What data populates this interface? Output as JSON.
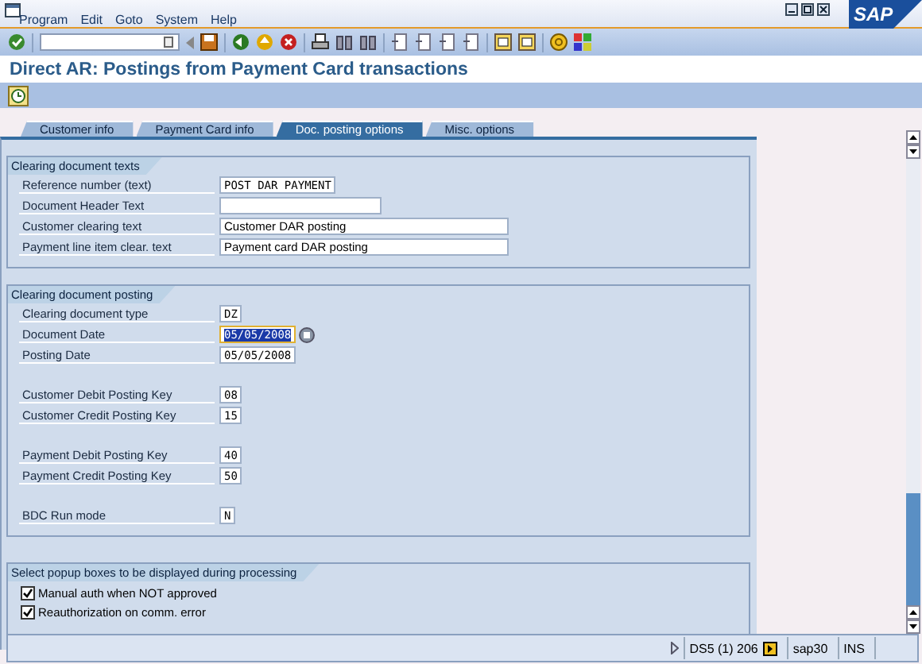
{
  "menu": [
    "Program",
    "Edit",
    "Goto",
    "System",
    "Help"
  ],
  "logo": "SAP",
  "title": "Direct AR: Postings from Payment Card transactions",
  "tabs": [
    {
      "label": "Customer info",
      "selected": false
    },
    {
      "label": "Payment Card info",
      "selected": false
    },
    {
      "label": "Doc. posting options",
      "selected": true
    },
    {
      "label": "Misc. options",
      "selected": false
    }
  ],
  "groups": [
    {
      "title": "Clearing document texts",
      "kind": "fields",
      "blocks": [
        [
          {
            "label": "Reference number (text)",
            "value": "POST DAR PAYMENT",
            "kind": "code",
            "selected": false
          },
          {
            "label": "Document Header Text",
            "kind": "text",
            "selected": false
          },
          {
            "label": "Customer clearing text",
            "value": "Customer DAR posting",
            "kind": "text",
            "selected": false
          },
          {
            "label": "Payment line item clear. text",
            "value": "Payment card DAR posting",
            "kind": "text",
            "selected": false
          }
        ]
      ]
    },
    {
      "title": "Clearing document posting",
      "kind": "fields",
      "blocks": [
        [
          {
            "label": "Clearing document type",
            "value": "DZ",
            "kind": "code",
            "selected": false
          },
          {
            "label": "Document Date",
            "value": "05/05/2008",
            "kind": "code",
            "selected": true
          },
          {
            "label": "Posting Date",
            "value": "05/05/2008",
            "kind": "code",
            "selected": false
          }
        ],
        [
          {
            "label": "Customer Debit Posting Key",
            "value": "08",
            "kind": "code",
            "selected": false
          },
          {
            "label": "Customer Credit Posting Key",
            "value": "15",
            "kind": "code",
            "selected": false
          }
        ],
        [
          {
            "label": "Payment Debit Posting Key",
            "value": "40",
            "kind": "code",
            "selected": false
          },
          {
            "label": "Payment Credit Posting Key",
            "value": "50",
            "kind": "code",
            "selected": false
          }
        ],
        [
          {
            "label": "BDC Run mode",
            "value": "N",
            "kind": "code",
            "selected": false
          }
        ]
      ]
    },
    {
      "title": "Select popup boxes to be displayed during processing",
      "kind": "checks",
      "rows": [
        {
          "label": "Manual auth when NOT approved",
          "checked": true
        },
        {
          "label": "Reauthorization on comm. error",
          "checked": true
        }
      ]
    }
  ],
  "status_bar": {
    "system": "DS5 (1) 206",
    "server": "sap30",
    "mode": "INS"
  }
}
